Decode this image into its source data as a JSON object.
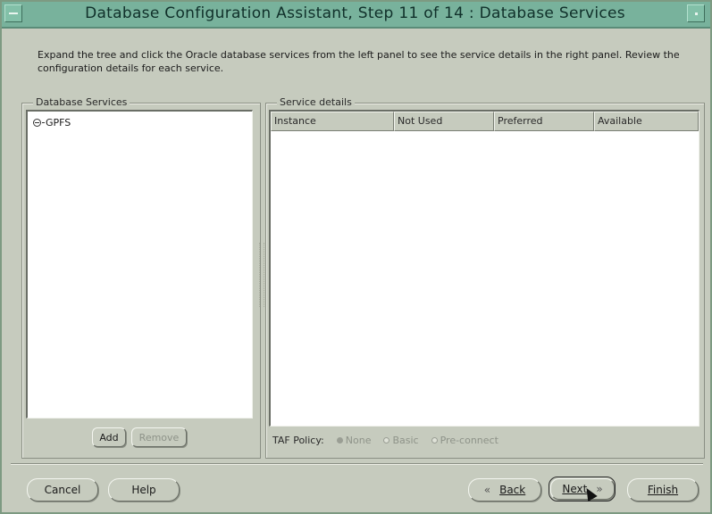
{
  "window": {
    "title": "Database Configuration Assistant, Step 11 of 14 : Database Services"
  },
  "description": "Expand the tree and click the Oracle database services from the left panel to see the service details in the right panel. Review the configuration details for each service.",
  "services_panel": {
    "label": "Database Services",
    "tree_items": [
      "GPFS"
    ],
    "add_label": "Add",
    "remove_label": "Remove"
  },
  "details_panel": {
    "label": "Service details",
    "columns": [
      "Instance",
      "Not Used",
      "Preferred",
      "Available"
    ],
    "taf_label": "TAF Policy:",
    "taf_options": [
      {
        "label": "None",
        "selected": true
      },
      {
        "label": "Basic",
        "selected": false
      },
      {
        "label": "Pre-connect",
        "selected": false
      }
    ]
  },
  "footer": {
    "cancel_label": "Cancel",
    "help_label": "Help",
    "back_label": "Back",
    "next_label": "Next",
    "finish_label": "Finish",
    "back_arrow": "«",
    "next_arrow": "»"
  }
}
